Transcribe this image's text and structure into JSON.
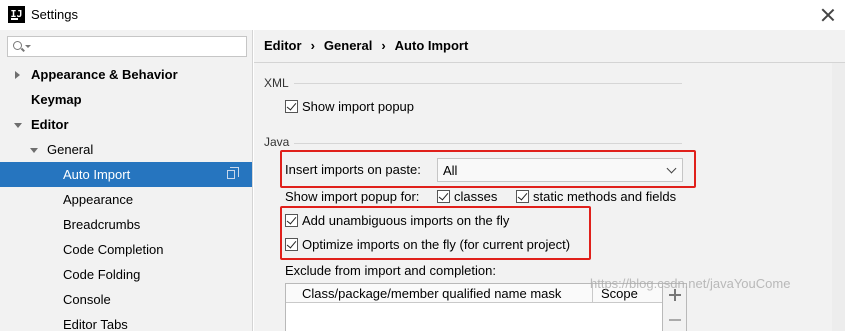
{
  "window": {
    "title": "Settings",
    "app_icon_text": "IJ"
  },
  "search": {
    "value": "",
    "placeholder": ""
  },
  "sidebar": {
    "items": [
      {
        "label": "Appearance & Behavior"
      },
      {
        "label": "Keymap"
      },
      {
        "label": "Editor"
      },
      {
        "label": "General"
      },
      {
        "label": "Auto Import"
      },
      {
        "label": "Appearance"
      },
      {
        "label": "Breadcrumbs"
      },
      {
        "label": "Code Completion"
      },
      {
        "label": "Code Folding"
      },
      {
        "label": "Console"
      },
      {
        "label": "Editor Tabs"
      }
    ]
  },
  "breadcrumb": {
    "items": [
      "Editor",
      "General",
      "Auto Import"
    ],
    "separator": "›"
  },
  "xml": {
    "section": "XML",
    "show_popup": {
      "label": "Show import popup",
      "checked": true
    }
  },
  "java": {
    "section": "Java",
    "insert_on_paste": {
      "label": "Insert imports on paste:",
      "value": "All"
    },
    "show_popup_for": {
      "label": "Show import popup for:",
      "classes": {
        "label": "classes",
        "checked": true
      },
      "static_methods": {
        "label": "static methods and fields",
        "checked": true
      }
    },
    "add_unambiguous": {
      "label": "Add unambiguous imports on the fly",
      "checked": true
    },
    "optimize_imports": {
      "label": "Optimize imports on the fly (for current project)",
      "checked": true
    },
    "exclude_label": "Exclude from import and completion:",
    "table": {
      "columns": [
        "Class/package/member qualified name mask",
        "Scope"
      ],
      "rows": []
    }
  },
  "watermark": "https://blog.csdn.net/javaYouCome",
  "colors": {
    "selection": "#2675bf",
    "highlight_box": "#e0201b"
  }
}
